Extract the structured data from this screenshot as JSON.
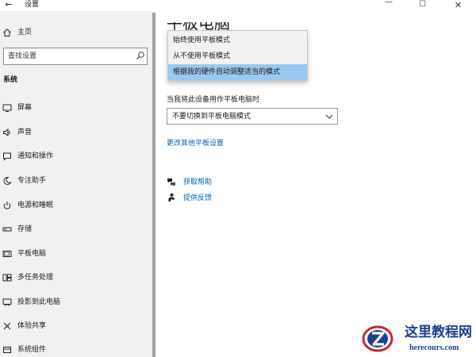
{
  "window": {
    "title": "设置",
    "back_glyph": "←",
    "min_glyph": "—",
    "max_glyph": "☐",
    "close_glyph": "✕"
  },
  "sidebar": {
    "home_label": "主页",
    "search_placeholder": "查找设置",
    "section_title": "系统",
    "items": [
      {
        "label": "屏幕",
        "icon": "monitor-icon"
      },
      {
        "label": "声音",
        "icon": "speaker-icon"
      },
      {
        "label": "通知和操作",
        "icon": "notification-icon"
      },
      {
        "label": "专注助手",
        "icon": "moon-icon"
      },
      {
        "label": "电源和睡眠",
        "icon": "power-icon"
      },
      {
        "label": "存储",
        "icon": "storage-icon"
      },
      {
        "label": "平板电脑",
        "icon": "tablet-icon"
      },
      {
        "label": "多任务处理",
        "icon": "multitask-icon"
      },
      {
        "label": "投影到此电脑",
        "icon": "project-icon"
      },
      {
        "label": "体验共享",
        "icon": "share-icon"
      },
      {
        "label": "系统组件",
        "icon": "components-icon"
      }
    ]
  },
  "main": {
    "page_title": "平板电脑",
    "dropdown_options": [
      "始终使用平板模式",
      "从不使用平板模式",
      "根据我的硬件自动调整适当的模式"
    ],
    "selected_option_index": 2,
    "combo_label": "当我将此设备用作平板电脑时",
    "combo_value": "不要切换到平板电脑模式",
    "more_settings_link": "更改其他平板设置",
    "help_link": "获取帮助",
    "feedback_link": "提供反馈"
  },
  "watermark": {
    "cn": "这里教程网",
    "en": "herecours.com"
  },
  "colors": {
    "accent": "#0063b1",
    "selection": "#99c9ef",
    "sidebar_bg": "#f1f1f1",
    "watermark": "#1d3f8f"
  }
}
